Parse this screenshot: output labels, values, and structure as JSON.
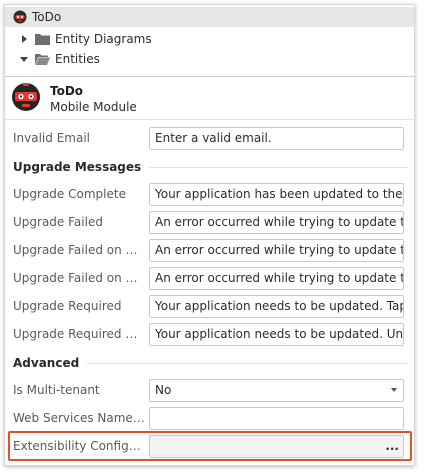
{
  "tree": {
    "items": [
      {
        "label": "ToDo",
        "icon": "robot-app-icon",
        "selected": true
      },
      {
        "label": "Entity Diagrams",
        "icon": "folder-icon",
        "expanded": false
      },
      {
        "label": "Entities",
        "icon": "folder-open-icon",
        "expanded": true
      }
    ]
  },
  "module": {
    "title": "ToDo",
    "subtitle": "Mobile Module",
    "icon": "robot-module-icon"
  },
  "properties": {
    "invalid_email": {
      "label": "Invalid Email",
      "value": "Enter a valid email."
    },
    "upgrade_section": "Upgrade Messages",
    "upgrade_rows": [
      {
        "label": "Upgrade Complete",
        "value": "Your application has been updated to the la"
      },
      {
        "label": "Upgrade Failed",
        "value": "An error occurred while trying to update the"
      },
      {
        "label": "Upgrade Failed on Re...",
        "value": "An error occurred while trying to update the"
      },
      {
        "label": "Upgrade Failed on Da...",
        "value": "An error occurred while trying to update the"
      },
      {
        "label": "Upgrade Required",
        "value": "Your application needs to be updated. Tap h"
      },
      {
        "label": "Upgrade Required wi...",
        "value": "Your application needs to be updated. Unsa"
      }
    ],
    "advanced_section": "Advanced",
    "multi_tenant": {
      "label": "Is Multi-tenant",
      "value": "No"
    },
    "web_services": {
      "label": "Web Services Names...",
      "value": ""
    },
    "extensibility": {
      "label": "Extensibility Configur...",
      "value": "",
      "button": "..."
    }
  },
  "colors": {
    "highlight": "#e0502b",
    "selected_row": "#e6e6e6"
  }
}
